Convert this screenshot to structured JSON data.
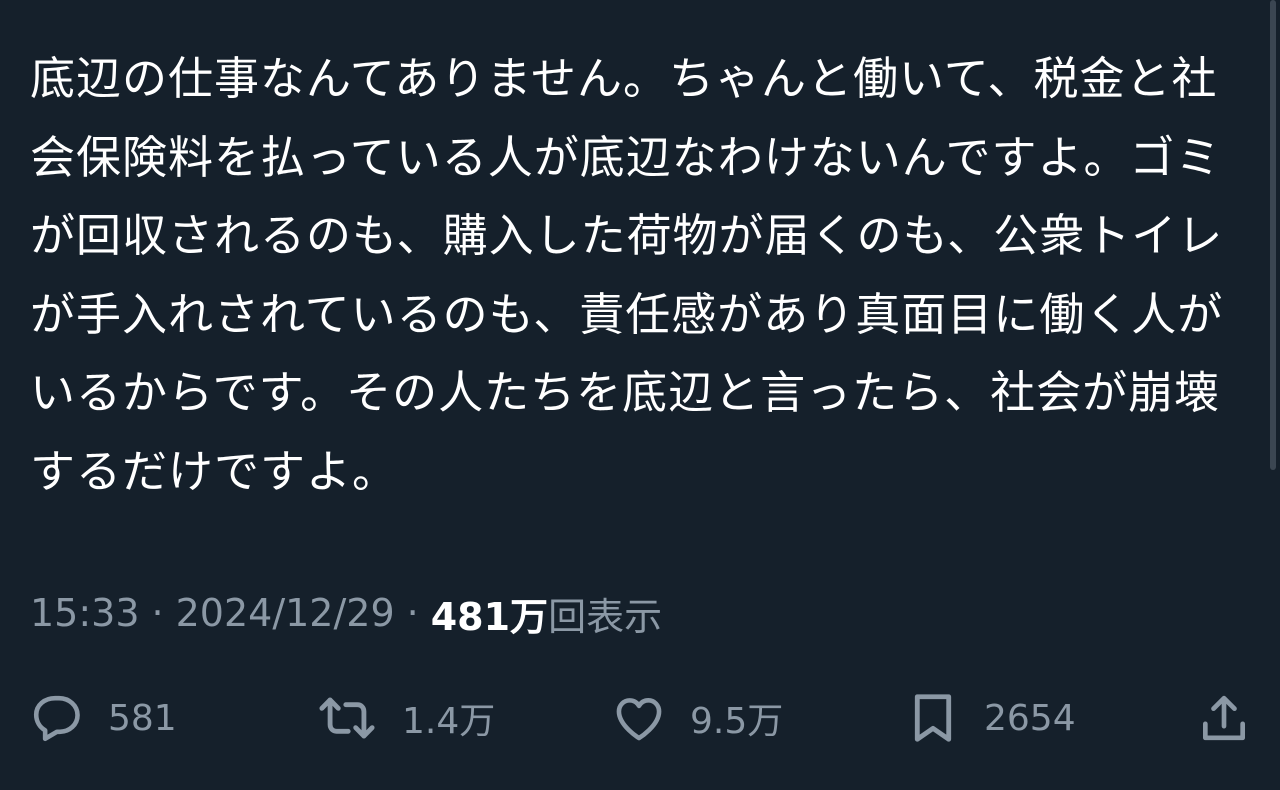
{
  "tweet": {
    "text": "底辺の仕事なんてありません。ちゃんと働いて、税金と社会保険料を払っている人が底辺なわけないんですよ。ゴミが回収されるのも、購入した荷物が届くのも、公衆トイレが手入れされているのも、責任感があり真面目に働く人がいるからです。その人たちを底辺と言ったら、社会が崩壊するだけですよ。"
  },
  "meta": {
    "time": "15:33",
    "separator": "·",
    "date": "2024/12/29",
    "views_count": "481万",
    "views_label": "回表示"
  },
  "actions": {
    "reply": {
      "icon": "reply-icon",
      "count": "581"
    },
    "repost": {
      "icon": "repost-icon",
      "count": "1.4万"
    },
    "like": {
      "icon": "heart-icon",
      "count": "9.5万"
    },
    "bookmark": {
      "icon": "bookmark-icon",
      "count": "2654"
    },
    "share": {
      "icon": "share-icon"
    }
  },
  "colors": {
    "background": "#15202b",
    "text": "#ffffff",
    "secondary": "#8b98a5"
  }
}
